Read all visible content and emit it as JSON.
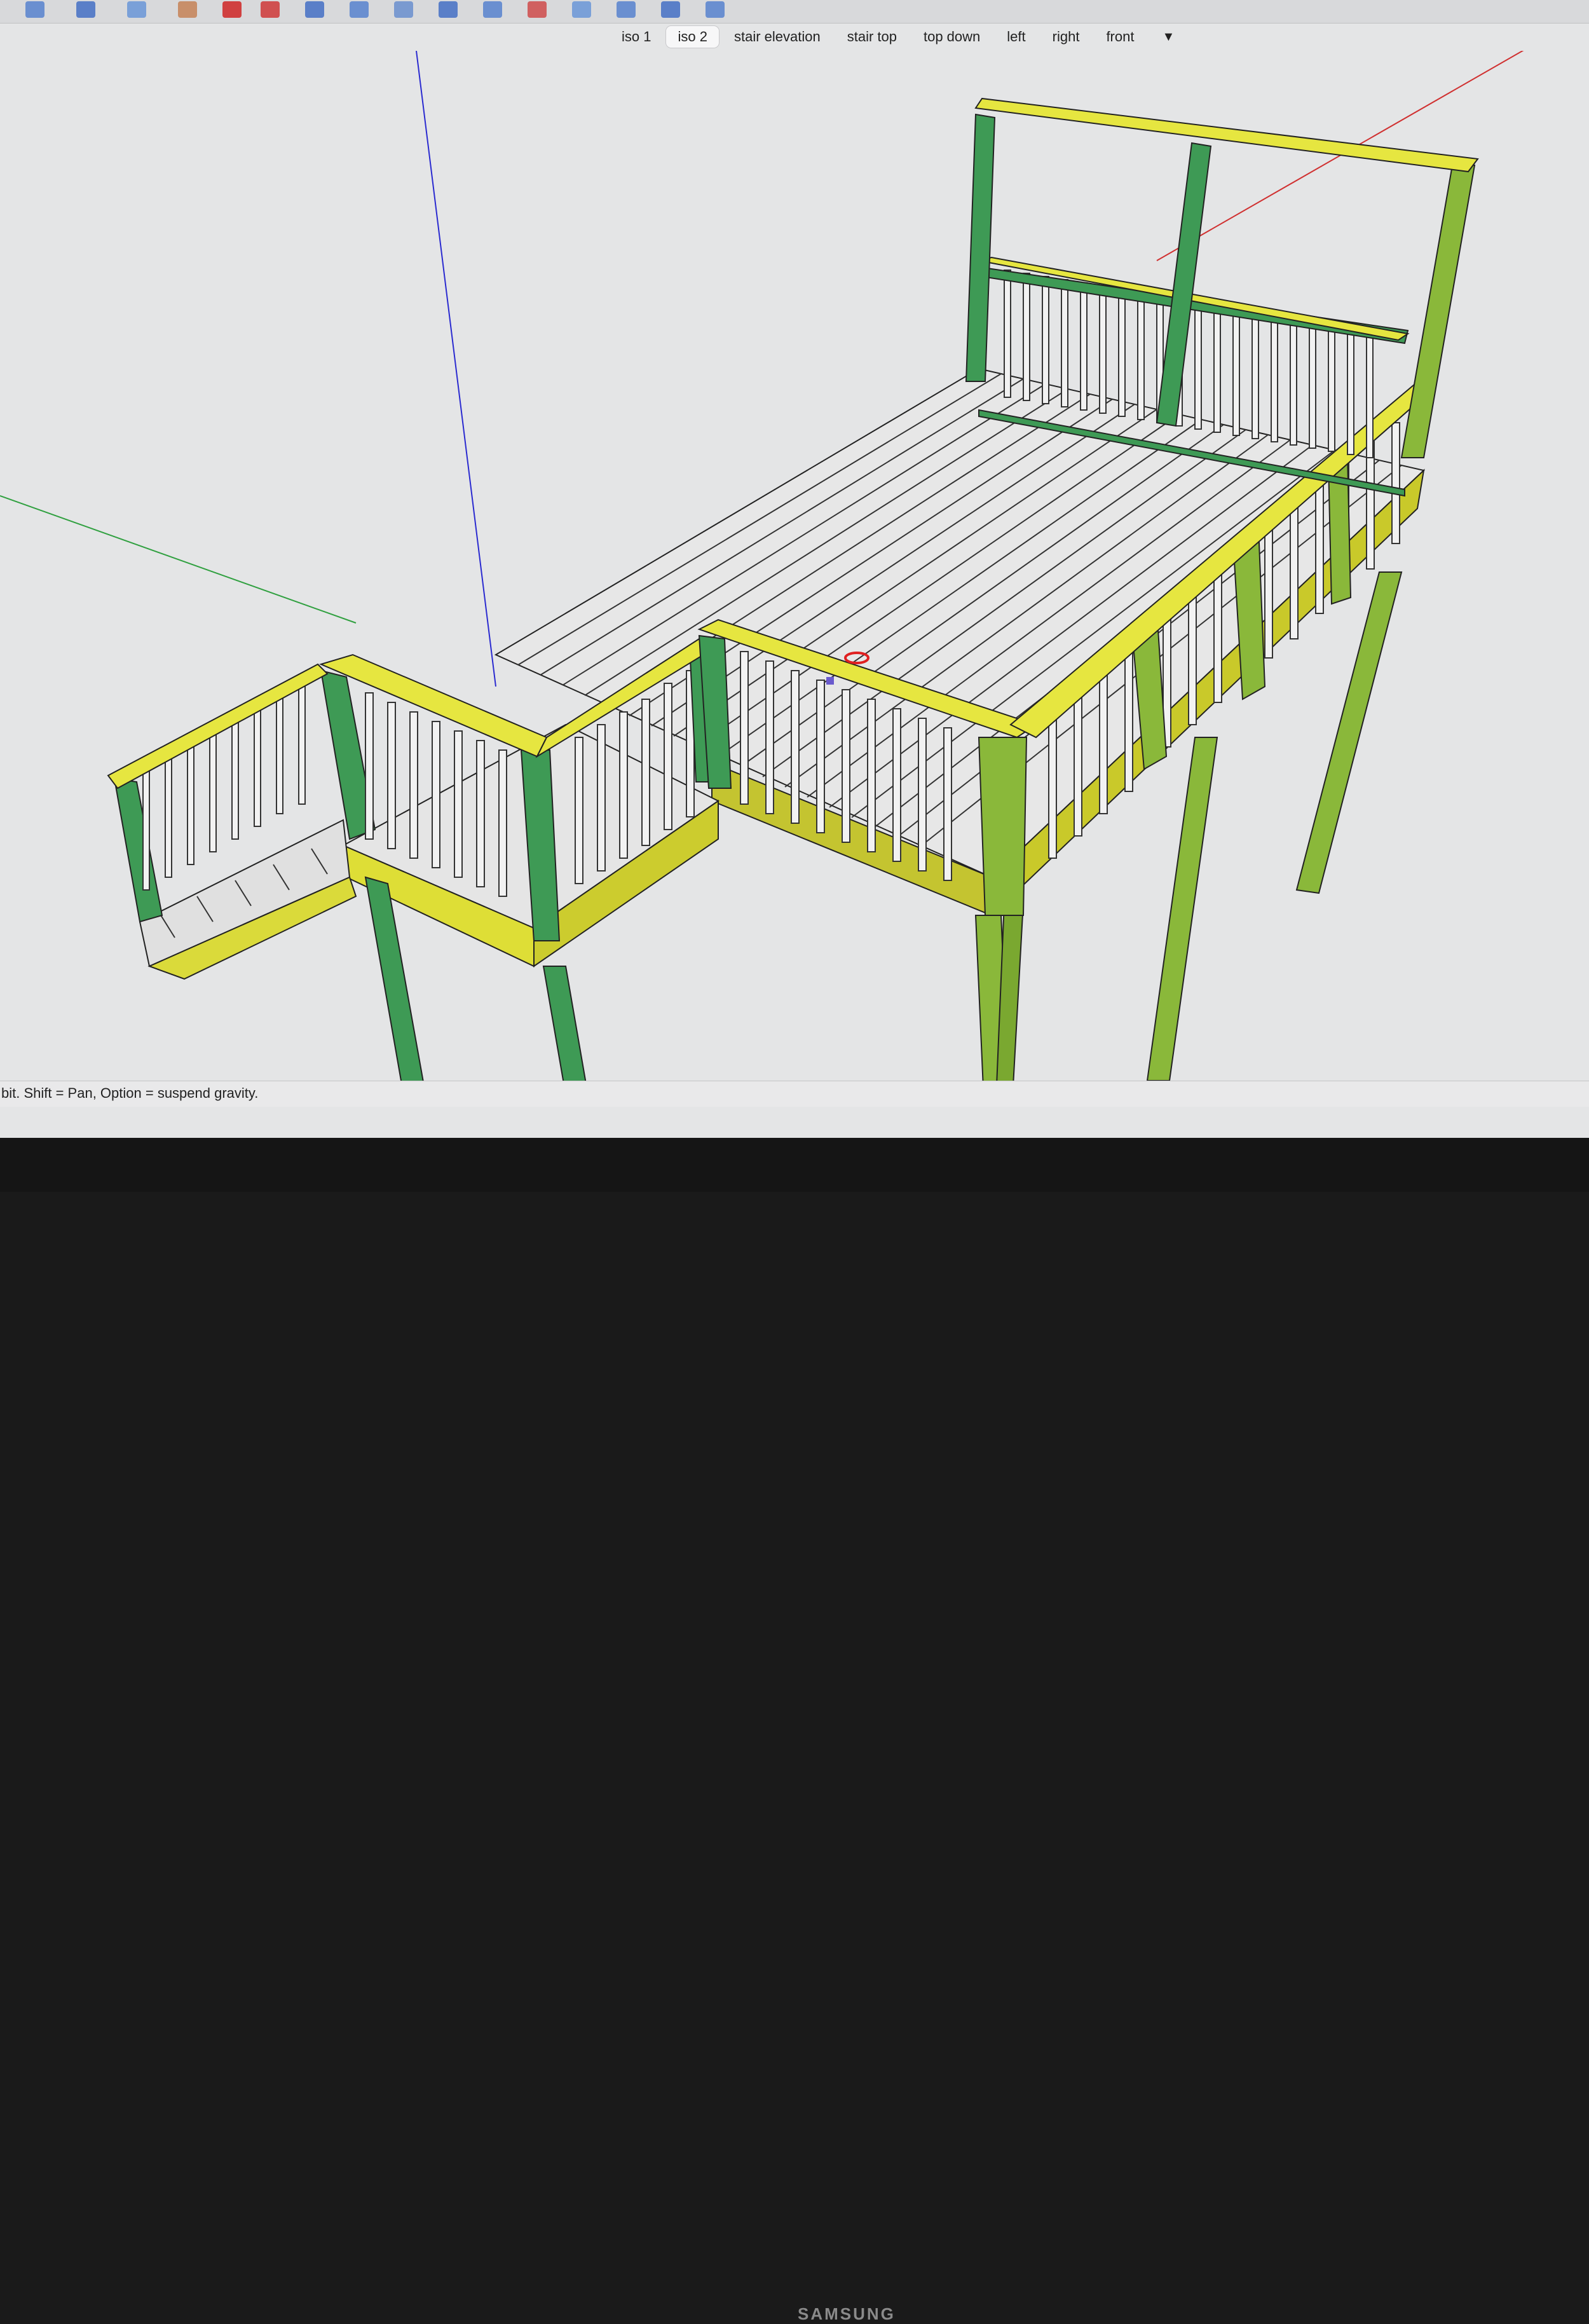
{
  "toolbar": {
    "icons": [
      "select-icon",
      "eraser-icon",
      "paint-icon",
      "orbit-icon",
      "move-icon",
      "rotate-icon",
      "push-pull-icon",
      "scale-icon",
      "tape-icon",
      "text-icon",
      "dimension-icon",
      "section-icon",
      "walk-icon",
      "look-icon",
      "zoom-icon",
      "zoom-extents-icon"
    ]
  },
  "scenes": {
    "tabs": [
      "iso 1",
      "iso 2",
      "stair elevation",
      "stair top",
      "top down",
      "left",
      "right",
      "front"
    ],
    "active": "iso 2",
    "more_icon": "triangle-down-icon"
  },
  "status": {
    "hint": "bit. Shift = Pan, Option = suspend gravity."
  },
  "monitor": {
    "brand": "SAMSUNG"
  },
  "colors": {
    "rail_yellow": "#e6e640",
    "post_green": "#3e9a55",
    "post_olive": "#8ab83a",
    "decking": "#e9e9e9",
    "axis_blue": "#2a2ad0",
    "axis_red": "#d03030",
    "axis_green": "#30a040"
  }
}
